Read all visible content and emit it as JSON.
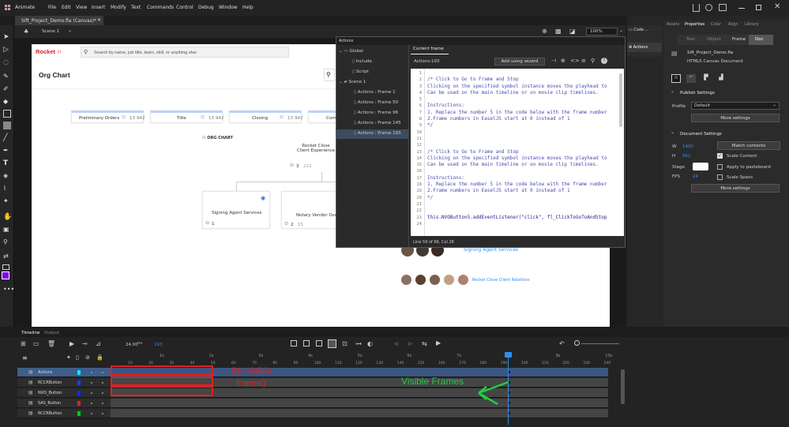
{
  "menubar": {
    "app_name": "Animate",
    "items": [
      "File",
      "Edit",
      "View",
      "Insert",
      "Modify",
      "Text",
      "Commands",
      "Control",
      "Debug",
      "Window",
      "Help"
    ]
  },
  "document_tab": {
    "label": "Sift_Project_Demo.fla (Canvas)*"
  },
  "stage_bar": {
    "scene_label": "Scene 1",
    "zoom": "100%"
  },
  "mini_panels": {
    "code_label": "Code ...",
    "actions_label": "Actions"
  },
  "canvas": {
    "logo_text": "Rocket",
    "search_placeholder": "Search by name, job title, team, skill, or anything else",
    "page_title": "Org Chart",
    "columns": [
      {
        "label": "Preliminary Orders",
        "count": "13",
        "extra": "942"
      },
      {
        "label": "Title",
        "count": "13",
        "extra": "942"
      },
      {
        "label": "Closing",
        "count": "13",
        "extra": "942"
      },
      {
        "label": "Comm",
        "count": "",
        "extra": ""
      }
    ],
    "org_chart_label": "ORG CHART",
    "node_rocket_close": {
      "line1": "Rocket Close",
      "line2": "Client Experience",
      "count": "3",
      "extra": "212"
    },
    "node_signing": {
      "label": "Signing Agent Services",
      "count": "1"
    },
    "node_notary": {
      "label": "Notary Vendor Ove",
      "count": "2",
      "extra": "15"
    },
    "team_signing_label": "Signing Agent Services",
    "team_relations_label": "Rocket Close Client Relations"
  },
  "actions_panel": {
    "title": "Actions",
    "tree": {
      "global": "Global",
      "include": "Include",
      "script": "Script",
      "scene": "Scene 1",
      "frames": [
        "Actions : Frame 1",
        "Actions : Frame 50",
        "Actions : Frame 96",
        "Actions : Frame 145",
        "Actions : Frame 193"
      ]
    },
    "current_frame_tab": "Current frame",
    "location": "Actions:193",
    "add_wizard_label": "Add using wizard",
    "status_line": "Line 59 of 66, Col 28",
    "line_numbers": [
      "1",
      "2",
      "3",
      "4",
      "5",
      "6",
      "7",
      "8",
      "9",
      "10",
      "11",
      "12",
      "13",
      "14",
      "15",
      "16",
      "17",
      "18",
      "19",
      "20",
      "21",
      "22",
      "23",
      "24"
    ],
    "code_lines": [
      "",
      "/* Click to Go to Frame and Stop",
      "Clicking on the specified symbol instance moves the playhead to",
      "Can be used on the main timeline or on movie clip timelines.",
      "",
      "Instructions:",
      "1. Replace the number 5 in the code below with the frame number",
      "2.Frame numbers in EaselJS start at 0 instead of 1",
      "*/",
      "",
      "",
      "",
      "/* Click to Go to Frame and Stop",
      "Clicking on the specified symbol instance moves the playhead to",
      "Can be used on the main timeline or on movie clip timelines.",
      "",
      "Instructions:",
      "1. Replace the number 5 in the code below with the frame number",
      "2.Frame numbers in EaselJS start at 0 instead of 1",
      "*/",
      "",
      "",
      "this.NVOButton5.addEventListener(\"click\", fl_ClickToGoToAndStop",
      ""
    ]
  },
  "right_panel": {
    "tabs": [
      "Assets",
      "Properties",
      "Color",
      "Align",
      "Library"
    ],
    "subtabs": [
      "Tool",
      "Object",
      "Frame",
      "Doc"
    ],
    "file_name": "Sift_Project_Demo.fla",
    "doc_type": "HTML5 Canvas Document",
    "publish_settings_title": "Publish Settings",
    "profile_label": "Profile",
    "profile_value": "Default",
    "more_settings_label": "More settings",
    "doc_settings_title": "Document Settings",
    "w_label": "W",
    "w_value": "1400",
    "h_label": "H",
    "h_value": "961",
    "match_contents_label": "Match contents",
    "scale_content_label": "Scale Content",
    "stage_label": "Stage",
    "apply_pasteboard_label": "Apply to pasteboard",
    "fps_label": "FPS",
    "fps_value": "24",
    "scale_spans_label": "Scale Spans",
    "more_settings_label2": "More settings"
  },
  "timeline": {
    "tabs": [
      "Timeline",
      "Output"
    ],
    "fps": "24.00",
    "fps_unit": "FPS",
    "current_frame": "193",
    "seconds": [
      "1s",
      "2s",
      "3s",
      "4s",
      "5s",
      "6s",
      "7s",
      "8s",
      "9s",
      "10s"
    ],
    "frame_ticks": [
      "10",
      "20",
      "30",
      "40",
      "50",
      "60",
      "70",
      "80",
      "90",
      "100",
      "110",
      "120",
      "130",
      "140",
      "150",
      "160",
      "170",
      "180",
      "190",
      "200",
      "210",
      "220",
      "230",
      "240"
    ],
    "layers": [
      "Actions",
      "RCCRButton",
      "NVO_Button",
      "SAS_Button",
      "RCCRButton"
    ],
    "layer_colors": [
      "#00e5ff",
      "#1f3cff",
      "#0033ff",
      "#ff1a1a",
      "#00d000"
    ],
    "annotation_red": "(No visible frames)",
    "annotation_green": "Visible Frames"
  },
  "colors": {
    "accent_blue": "#2e8ef0",
    "annotation_red": "#e02020",
    "annotation_green": "#22cc44",
    "swatch_fill": "#7a00ff",
    "rocket_red": "#d71f26"
  }
}
